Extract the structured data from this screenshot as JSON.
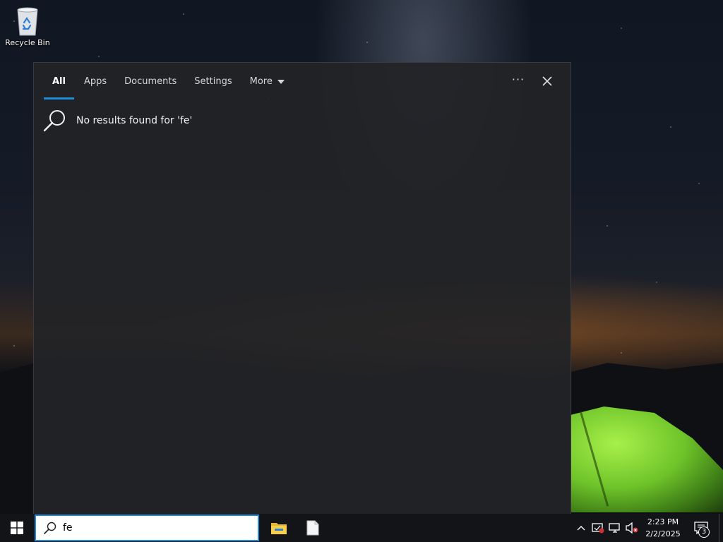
{
  "desktop": {
    "icons": [
      {
        "label": "Recycle Bin"
      }
    ]
  },
  "search_panel": {
    "tabs": [
      {
        "label": "All",
        "active": true
      },
      {
        "label": "Apps"
      },
      {
        "label": "Documents"
      },
      {
        "label": "Settings"
      },
      {
        "label": "More",
        "has_dropdown": true
      }
    ],
    "more_options_label": "···",
    "no_results_text": "No results found for 'fe'",
    "accent_color": "#1f8bd6"
  },
  "taskbar": {
    "search_value": "fe",
    "pinned_apps": [
      {
        "name": "File Explorer",
        "icon": "file-explorer-icon"
      },
      {
        "name": "Document",
        "icon": "document-icon"
      }
    ],
    "tray": {
      "icons": [
        "chevron-up-icon",
        "security-icon",
        "network-icon",
        "volume-muted-icon"
      ],
      "time": "2:23 PM",
      "date": "2/2/2025",
      "notification_count": "3"
    }
  }
}
